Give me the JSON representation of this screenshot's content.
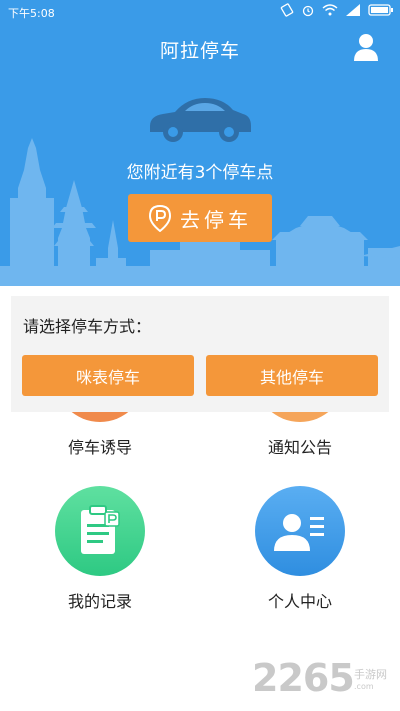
{
  "status_bar": {
    "time": "下午5:08",
    "icons": [
      "rotate-icon",
      "alarm-icon",
      "wifi-icon",
      "signal-icon",
      "battery-icon"
    ]
  },
  "header": {
    "title": "阿拉停车",
    "profile_icon": "user-icon"
  },
  "hero": {
    "car_icon": "car-icon",
    "nearby_text": "您附近有3个停车点",
    "go_park_label": "去停车",
    "go_park_icon": "parking-pin-icon",
    "colors": {
      "background": "#3a9be8",
      "accent": "#f4973a"
    }
  },
  "dialog": {
    "title": "请选择停车方式：",
    "buttons": [
      {
        "label": "咪表停车"
      },
      {
        "label": "其他停车"
      }
    ]
  },
  "menu": {
    "items": [
      {
        "label": "停车诱导",
        "icon": "guide-icon",
        "color": "#f08a4b"
      },
      {
        "label": "通知公告",
        "icon": "notice-icon",
        "color": "#f5a55a"
      },
      {
        "label": "我的记录",
        "icon": "clipboard-icon",
        "color": "#34cc88"
      },
      {
        "label": "个人中心",
        "icon": "user-card-icon",
        "color": "#3d9ae8"
      }
    ]
  },
  "watermark": {
    "number": "2265",
    "site": "手游网",
    "url": ".com"
  }
}
